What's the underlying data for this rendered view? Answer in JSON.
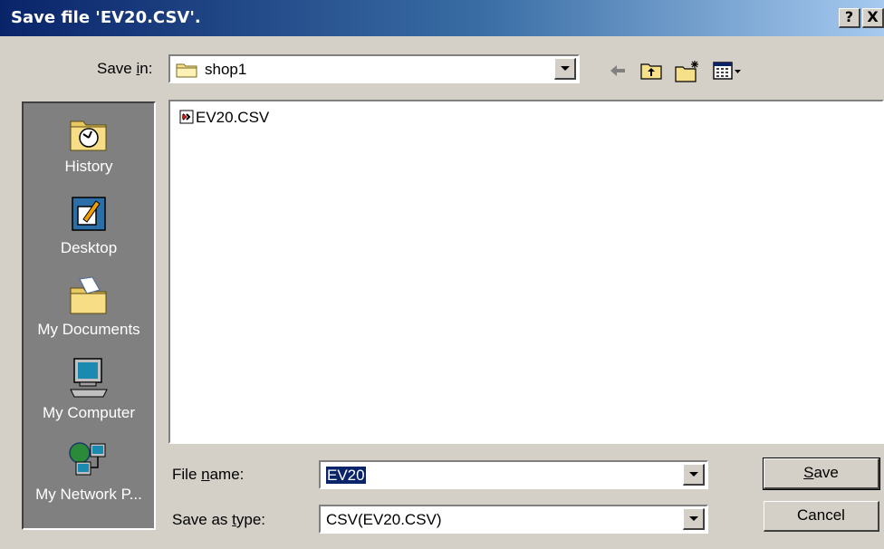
{
  "window": {
    "title": "Save file 'EV20.CSV'.",
    "help_label": "?",
    "close_label": "X"
  },
  "save_in": {
    "label_pre": "Save ",
    "label_accel": "i",
    "label_post": "n:",
    "value": "shop1"
  },
  "toolbar": {
    "icons": [
      "back-icon",
      "up-folder-icon",
      "new-folder-icon",
      "view-menu-icon"
    ]
  },
  "places": [
    {
      "label": "History",
      "icon": "history-icon"
    },
    {
      "label": "Desktop",
      "icon": "desktop-icon"
    },
    {
      "label": "My Documents",
      "icon": "my-documents-icon"
    },
    {
      "label": "My Computer",
      "icon": "my-computer-icon"
    },
    {
      "label": "My Network P...",
      "icon": "network-places-icon"
    }
  ],
  "files": [
    {
      "name": "EV20.CSV",
      "icon": "csv-file-icon"
    }
  ],
  "file_name": {
    "label_pre": "File ",
    "label_accel": "n",
    "label_post": "ame:",
    "value": "EV20"
  },
  "save_as_type": {
    "label_pre": "Save as ",
    "label_accel": "t",
    "label_post": "ype:",
    "value": "CSV(EV20.CSV)"
  },
  "buttons": {
    "save_accel": "S",
    "save_rest": "ave",
    "cancel": "Cancel"
  }
}
